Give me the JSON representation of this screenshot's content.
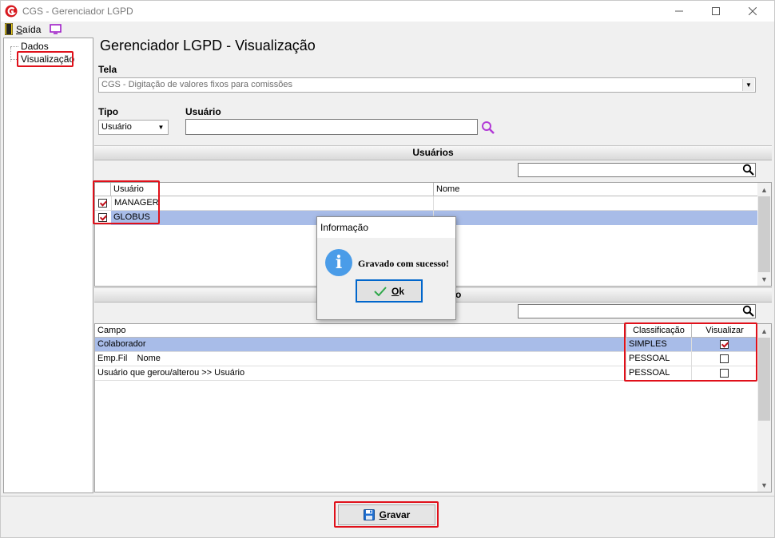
{
  "window": {
    "title": "CGS - Gerenciador LGPD"
  },
  "menu": {
    "exit_label_rest": "aída",
    "exit_label_first": "S"
  },
  "tree": {
    "items": [
      "Dados",
      "Visualização"
    ]
  },
  "page": {
    "title": "Gerenciador LGPD - Visualização"
  },
  "tela": {
    "label": "Tela",
    "value": "CGS - Digitação de valores fixos para comissões"
  },
  "tipo": {
    "label": "Tipo",
    "value": "Usuário"
  },
  "usuario": {
    "label": "Usuário",
    "value": ""
  },
  "users_section": {
    "title": "Usuários",
    "search_value": "",
    "columns": [
      "Usuário",
      "Nome"
    ],
    "rows": [
      {
        "usuario": "MANAGER",
        "nome": "",
        "checked": true
      },
      {
        "usuario": "GLOBUS",
        "nome": "",
        "checked": true
      }
    ]
  },
  "fields_section": {
    "title_visible_fragment": "o",
    "search_value": "",
    "columns": [
      "Campo",
      "Classificação",
      "Visualizar"
    ],
    "rows": [
      {
        "campo": "Colaborador",
        "classificacao": "SIMPLES",
        "visualizar": true
      },
      {
        "campo": "Emp.Fil    Nome",
        "classificacao": "PESSOAL",
        "visualizar": false
      },
      {
        "campo": "Usuário que gerou/alterou >> Usuário",
        "classificacao": "PESSOAL",
        "visualizar": false
      }
    ]
  },
  "dialog": {
    "title": "Informação",
    "message": "Gravado com sucesso!",
    "ok_first": "O",
    "ok_rest": "k"
  },
  "gravar": {
    "first": "G",
    "rest": "ravar"
  },
  "colors": {
    "highlight": "#e0101a",
    "selection": "#a8bce8",
    "accent": "#0066cc"
  }
}
